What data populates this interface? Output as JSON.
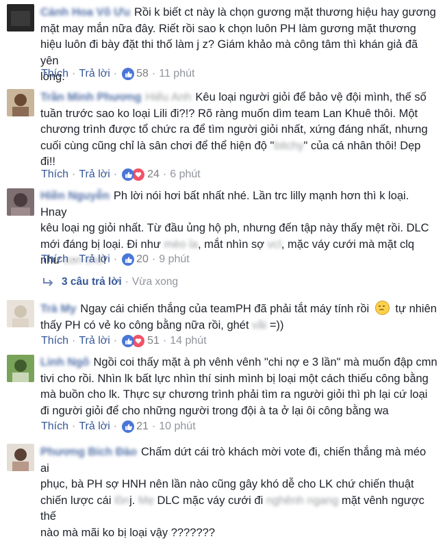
{
  "actions_text": {
    "like": "Thích",
    "reply": "Trả lời",
    "separator": "·"
  },
  "comments": [
    {
      "name": "Cánh Hoa Vô Ưu",
      "lines": [
        "Rồi k biết ct này là chọn gương mặt thương hiệu hay gương",
        "mặt may mắn nữa đây. Riết rồi sao k chọn luôn PH làm gương mặt thương",
        "hiệu luôn đi bày đặt thi thố làm j z? Giám khảo mà công tâm thì khán giả đã yên",
        "lòng."
      ],
      "reactions": [
        "like"
      ],
      "count": "58",
      "time": "11 phút"
    },
    {
      "name": "Trần Minh Phương",
      "name_extra": "Hiếu Anh",
      "line1": "Kêu loại người giỏi để bảo vệ đội mình, thế số",
      "line2": "tuần trước sao ko loại Lili đi?!? Rõ ràng muốn dìm team Lan Khuê thôi. Một",
      "line3": "chương trình được tổ chức ra để tìm người giỏi nhất, xứng đáng nhất, nhưng",
      "line4_a": "cuối cùng cũng chỉ là sân chơi để thể hiện độ \"",
      "line4_blur": "bitchy",
      "line4_b": "\" của cá nhân thôi! Dẹp",
      "line5": "đi!!",
      "reactions": [
        "like",
        "love"
      ],
      "count": "24",
      "time": "6 phút"
    },
    {
      "name": "Hiền Nguyễn",
      "line1": "Ph lời nói hơi bất nhất nhé. Lần trc lilly mạnh hơn thì k loại. Hnay",
      "line2": "kêu loại ng giỏi nhất. Từ đầu ủng hộ ph, nhưng đến tập này thấy mệt rồi. DLC",
      "line3_a": "mới đáng bị loại. Đi như ",
      "line3_blur1": "mèo ỉa",
      "line3_b": ", mắt nhìn sợ ",
      "line3_blur2": "vcl",
      "line3_c": ", mặc váy cưới mà mặt clq",
      "line4_a": "như ",
      "line4_blur": "con chó",
      "line4_b": "!",
      "reactions": [
        "like"
      ],
      "count": "20",
      "time": "9 phút",
      "replies_label": "3 câu trả lời",
      "replies_time": "Vừa xong"
    },
    {
      "name": "Trà My",
      "line1_a": "Ngay cái chiến thắng của teamPH đã phải tắt máy tính rồi ",
      "line1_b": " tự nhiên",
      "line2_a": "thấy PH có vẻ ko công bằng nữa rồi, ghét ",
      "line2_blur": "vãi",
      "line2_b": " =))",
      "reactions": [
        "like",
        "love"
      ],
      "count": "51",
      "time": "14 phút"
    },
    {
      "name": "Linh Ngô",
      "line1": "Ngồi coi thấy mặt à ph vênh vênh \"chi nợ e 3 lần\" mà muốn đập cmn",
      "line2": "tivi cho rồi. Nhìn lk bất lực nhìn thí sinh mình bị loại một cách thiếu công bằng",
      "line3": "mà buồn cho lk. Thực sự chương trình phải tìm ra người giỏi thì ph lại cứ loại",
      "line4": "đi người giỏi để cho những người trong đội à ta ở lại ôi công bằng wa",
      "reactions": [
        "like"
      ],
      "count": "21",
      "time": "10 phút"
    },
    {
      "name": "Phương Bích Đào",
      "line1": "Chấm dứt cái trò khách mời vote đi, chiến thắng mà méo ai",
      "line2": "phục, bà PH sợ HNH nên lần nào cũng gây khó dễ cho LK chứ chiến thuật",
      "line3_a": "chiến lược cái ",
      "line3_blur1": "lồn",
      "line3_b": "j. ",
      "line3_blur2": "Mẹ",
      "line3_c": " DLC mặc váy cưới đi ",
      "line3_blur3": "nghênh ngang",
      "line3_d": " mặt vênh ngược thế",
      "line4": "nào mà mãi ko bị loại vậy ???????"
    }
  ],
  "colors": {
    "link": "#365899",
    "meta": "#90949c",
    "like": "#4a76d8",
    "love": "#f25268"
  }
}
